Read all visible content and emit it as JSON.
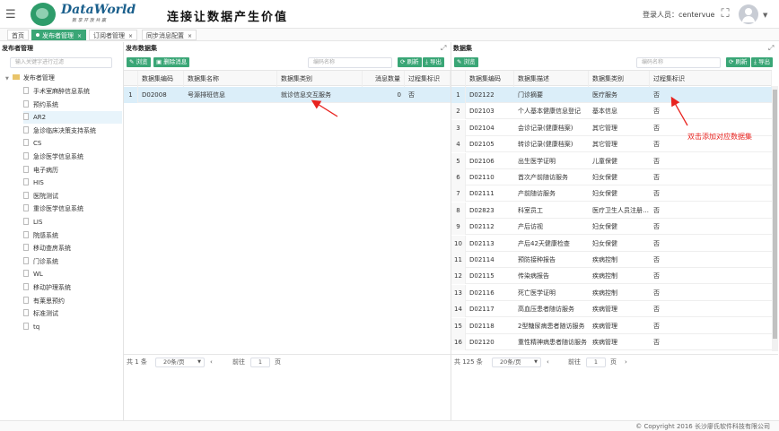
{
  "header": {
    "logo": "DataWorld",
    "logo_sub": "数 享 开 放 共 赢",
    "slogan": "连接让数据产生价值",
    "login": "登录人员：centervue"
  },
  "tabs": [
    {
      "label": "首页"
    },
    {
      "label": "发布者管理"
    },
    {
      "label": "订阅者管理"
    },
    {
      "label": "同步消息配置"
    }
  ],
  "left": {
    "title": "发布者管理",
    "search_placeholder": "输入关键字进行过滤",
    "root": "发布者管理",
    "items": [
      "手术室麻醉信息系统",
      "预约系统",
      "AR2",
      "急诊临床决策支持系统",
      "CS",
      "急诊医学信息系统",
      "电子病历",
      "HIS",
      "医院测试",
      "重诊医学信息系统",
      "LIS",
      "院感系统",
      "移动查房系统",
      "门诊系统",
      "WL",
      "移动护理系统",
      "有莱思预约",
      "标准测试",
      "tq"
    ]
  },
  "mid": {
    "title": "发布数据集",
    "btn_browse": "浏览",
    "btn_delete": "删除消息",
    "search_placeholder": "编码名称",
    "btn_refresh": "刷新",
    "btn_export": "导出",
    "headers": [
      "数据集编码",
      "数据集名称",
      "数据集类别",
      "消息数量",
      "过程集标识"
    ],
    "rows": [
      {
        "no": "1",
        "code": "D02008",
        "name": "号源排班信息",
        "category": "就诊信息交互服务",
        "count": "0",
        "flag": "否"
      }
    ],
    "total": "共 1 条",
    "page_size": "20条/页",
    "goto": "前往",
    "page": "1",
    "page_unit": "页"
  },
  "right": {
    "title": "数据集",
    "btn_browse": "浏览",
    "search_placeholder": "编码名称",
    "btn_refresh": "刷新",
    "btn_export": "导出",
    "headers": [
      "数据集编码",
      "数据集描述",
      "数据集类别",
      "过程集标识"
    ],
    "rows": [
      {
        "no": "1",
        "code": "D02122",
        "desc": "门诊摘要",
        "category": "医疗服务",
        "flag": "否"
      },
      {
        "no": "2",
        "code": "D02103",
        "desc": "个人基本健康信息登记",
        "category": "基本信息",
        "flag": "否"
      },
      {
        "no": "3",
        "code": "D02104",
        "desc": "会诊记录(健康档案)",
        "category": "其它管理",
        "flag": "否"
      },
      {
        "no": "4",
        "code": "D02105",
        "desc": "转诊记录(健康档案)",
        "category": "其它管理",
        "flag": "否"
      },
      {
        "no": "5",
        "code": "D02106",
        "desc": "出生医学证明",
        "category": "儿童保健",
        "flag": "否"
      },
      {
        "no": "6",
        "code": "D02110",
        "desc": "首次产前随访服务",
        "category": "妇女保健",
        "flag": "否"
      },
      {
        "no": "7",
        "code": "D02111",
        "desc": "产前随访服务",
        "category": "妇女保健",
        "flag": "否"
      },
      {
        "no": "8",
        "code": "D02823",
        "desc": "科室员工",
        "category": "医疗卫生人员注册…",
        "flag": "否"
      },
      {
        "no": "9",
        "code": "D02112",
        "desc": "产后访视",
        "category": "妇女保健",
        "flag": "否"
      },
      {
        "no": "10",
        "code": "D02113",
        "desc": "产后42天健康检查",
        "category": "妇女保健",
        "flag": "否"
      },
      {
        "no": "11",
        "code": "D02114",
        "desc": "预防接种报告",
        "category": "疾病控制",
        "flag": "否"
      },
      {
        "no": "12",
        "code": "D02115",
        "desc": "传染病报告",
        "category": "疾病控制",
        "flag": "否"
      },
      {
        "no": "13",
        "code": "D02116",
        "desc": "死亡医学证明",
        "category": "疾病控制",
        "flag": "否"
      },
      {
        "no": "14",
        "code": "D02117",
        "desc": "高血压患者随访服务",
        "category": "疾病管理",
        "flag": "否"
      },
      {
        "no": "15",
        "code": "D02118",
        "desc": "2型糖尿病患者随访服务",
        "category": "疾病管理",
        "flag": "否"
      },
      {
        "no": "16",
        "code": "D02120",
        "desc": "重性精神病患者随访服务",
        "category": "疾病管理",
        "flag": "否"
      }
    ],
    "total": "共 125 条",
    "page_size": "20条/页",
    "goto": "前往",
    "page": "1",
    "page_unit": "页"
  },
  "annotation": "双击添加对应数据集",
  "footer": "© Copyright 2016 长沙廖氏软件科技有限公司",
  "colors": {
    "accent": "#3aa676",
    "annotation": "#e8231f",
    "selected_row": "#dbeef9"
  }
}
